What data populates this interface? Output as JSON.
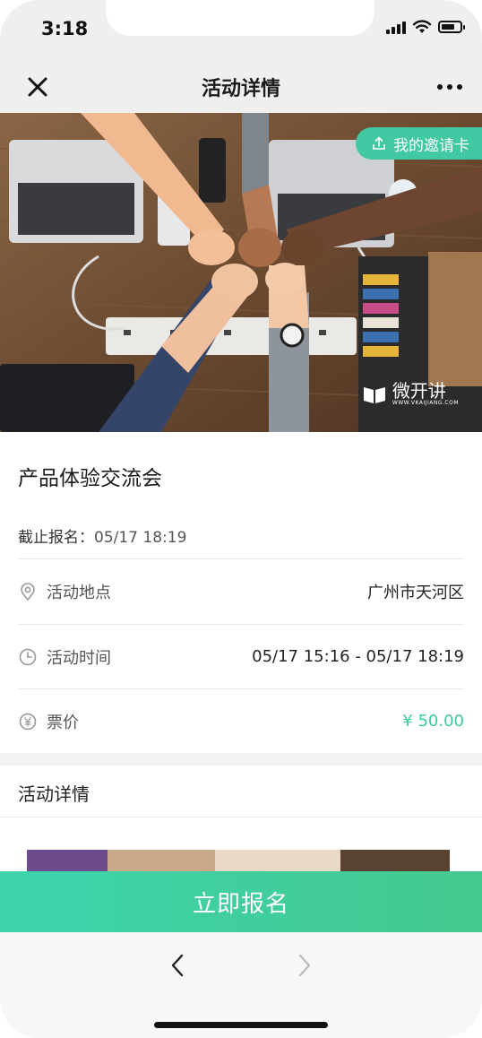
{
  "status_bar": {
    "time": "3:18"
  },
  "nav": {
    "title": "活动详情"
  },
  "hero": {
    "invite_label": "我的邀请卡",
    "watermark": "微开讲",
    "watermark_sub": "WWW.VKAIJIANG.COM"
  },
  "event": {
    "title": "产品体验交流会",
    "deadline_label": "截止报名：",
    "deadline_value": "05/17 18:19",
    "rows": [
      {
        "icon": "location-pin-icon",
        "label": "活动地点",
        "value": "广州市天河区"
      },
      {
        "icon": "clock-icon",
        "label": "活动时间",
        "value": "05/17 15:16 - 05/17 18:19"
      },
      {
        "icon": "yen-icon",
        "label": "票价",
        "value": "¥ 50.00"
      }
    ]
  },
  "details": {
    "heading": "活动详情"
  },
  "cta": {
    "label": "立即报名"
  },
  "colors": {
    "accent": "#40c9a2",
    "price": "#3ccaa0",
    "navbar": "#efefed"
  }
}
